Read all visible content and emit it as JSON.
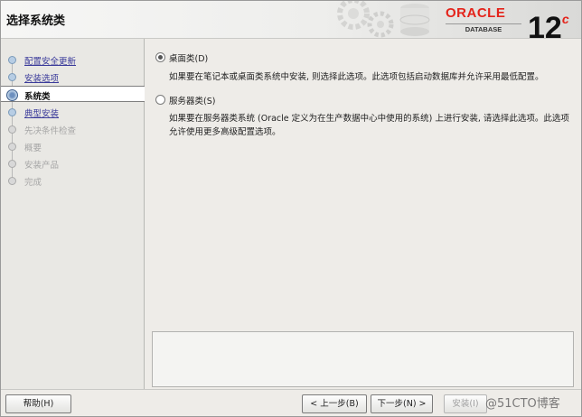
{
  "header": {
    "title": "选择系统类",
    "logo_word": "ORACLE",
    "logo_sub": "DATABASE",
    "version_main": "12",
    "version_sup": "c"
  },
  "sidebar": {
    "steps": [
      {
        "label": "配置安全更新",
        "state": "done"
      },
      {
        "label": "安装选项",
        "state": "done"
      },
      {
        "label": "系统类",
        "state": "current"
      },
      {
        "label": "典型安装",
        "state": "done"
      },
      {
        "label": "先决条件检查",
        "state": "disabled"
      },
      {
        "label": "概要",
        "state": "disabled"
      },
      {
        "label": "安装产品",
        "state": "disabled"
      },
      {
        "label": "完成",
        "state": "disabled"
      }
    ]
  },
  "main": {
    "options": [
      {
        "label": "桌面类(D)",
        "selected": true,
        "description": "如果要在笔记本或桌面类系统中安装, 则选择此选项。此选项包括启动数据库并允许采用最低配置。"
      },
      {
        "label": "服务器类(S)",
        "selected": false,
        "description": "如果要在服务器类系统 (Oracle 定义为在生产数据中心中使用的系统) 上进行安装, 请选择此选项。此选项允许使用更多高级配置选项。"
      }
    ]
  },
  "footer": {
    "help_label": "帮助(H)",
    "back_label": "< 上一步(B)",
    "next_label": "下一步(N) >",
    "install_label": "安装(I)"
  },
  "watermark": "@51CTO博客"
}
